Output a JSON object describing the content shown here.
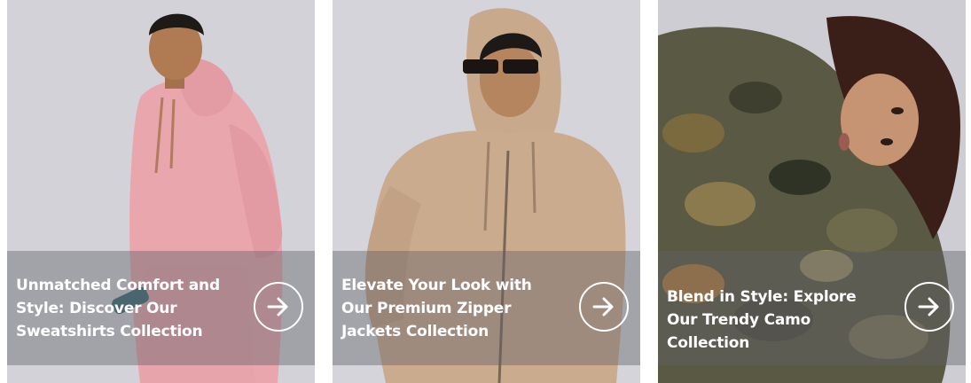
{
  "cards": [
    {
      "caption": "Unmatched Comfort and Style: Discover Our Sweatshirts Collection",
      "button_icon": "arrow-right-icon",
      "photo_subject": "man in pink hoodie"
    },
    {
      "caption": "Elevate Your Look with Our Premium Zipper Jackets Collection",
      "button_icon": "arrow-right-icon",
      "photo_subject": "man in beige zip hoodie"
    },
    {
      "caption": "Blend in Style: Explore Our Trendy Camo Collection",
      "button_icon": "arrow-right-icon",
      "photo_subject": "woman in camo hoodie"
    }
  ],
  "colors": {
    "overlay": "#5f5f69",
    "text": "#ffffff",
    "pink_hoodie": "#e8a6ab",
    "beige_hoodie": "#c9a88b",
    "background": "#cfcfd6"
  }
}
